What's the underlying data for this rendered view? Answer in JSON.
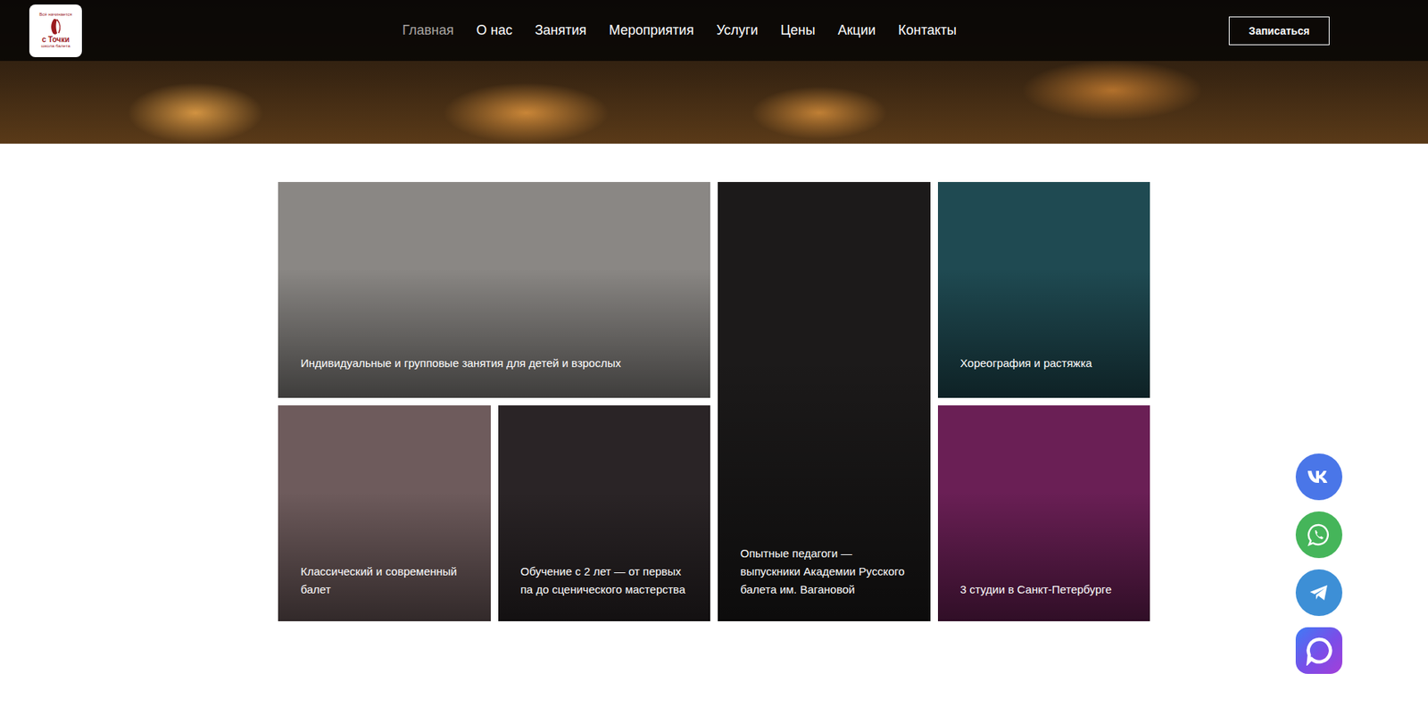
{
  "logo": {
    "lines": [
      "Всё начинается",
      "с Точки",
      "школа балета"
    ]
  },
  "nav": [
    {
      "label": "Главная",
      "selected": true
    },
    {
      "label": "О нас",
      "selected": false
    },
    {
      "label": "Занятия",
      "selected": false
    },
    {
      "label": "Мероприятия",
      "selected": false
    },
    {
      "label": "Услуги",
      "selected": false
    },
    {
      "label": "Цены",
      "selected": false
    },
    {
      "label": "Акции",
      "selected": false
    },
    {
      "label": "Контакты",
      "selected": false
    }
  ],
  "cta": "Записаться",
  "cards": [
    {
      "caption": "Индивидуальные и групповые занятия для детей и взрослых",
      "color": "#8a8784"
    },
    {
      "caption": "Опытные педагоги — выпускники Академии Русского балета им. Вагановой",
      "color": "#1c1a1a"
    },
    {
      "caption": "Хореография и растяжка",
      "color": "#1f4a52"
    },
    {
      "caption": "Классический и современный балет",
      "color": "#6e5b5c"
    },
    {
      "caption": "Обучение с 2 лет — от первых па до сценического мастерства",
      "color": "#2a2426"
    },
    {
      "caption": "3 студии в Санкт-Петербурге",
      "color": "#6a1f55"
    }
  ]
}
